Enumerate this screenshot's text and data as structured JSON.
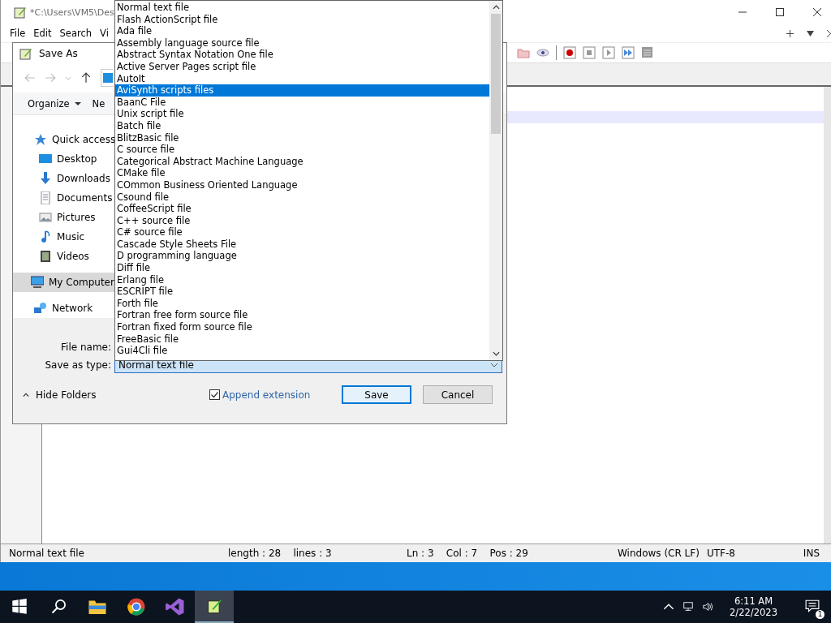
{
  "editor_window": {
    "title": "*C:\\Users\\VM5\\Des",
    "menu": [
      "File",
      "Edit",
      "Search",
      "Vi"
    ]
  },
  "save_dialog": {
    "title": "Save As",
    "commands": [
      {
        "label": "Organize",
        "kind": "menu"
      },
      {
        "label": "Ne",
        "kind": "plain"
      }
    ],
    "nav_items": [
      {
        "label": "Quick access",
        "kind": "star",
        "selected": false,
        "children": [
          {
            "label": "Desktop",
            "kind": "desktop",
            "selected": false
          },
          {
            "label": "Downloads",
            "kind": "download",
            "selected": false
          },
          {
            "label": "Documents",
            "kind": "document",
            "selected": false
          },
          {
            "label": "Pictures",
            "kind": "pictures",
            "selected": false
          },
          {
            "label": "Music",
            "kind": "music",
            "selected": false
          },
          {
            "label": "Videos",
            "kind": "videos",
            "selected": false
          }
        ]
      },
      {
        "label": "My Computer",
        "kind": "computer",
        "selected": true
      },
      {
        "label": "Network",
        "kind": "network",
        "selected": false
      }
    ],
    "file_name_label": "File name:",
    "save_type_label": "Save as type:",
    "save_type_value": "Normal text file",
    "append_extension": {
      "label": "Append extension",
      "checked": true
    },
    "hide_folders": "Hide Folders",
    "buttons": [
      {
        "label": "Save",
        "default": true
      },
      {
        "label": "Cancel",
        "default": false
      }
    ]
  },
  "type_list": [
    {
      "label": "Normal text file",
      "selected": false
    },
    {
      "label": "Flash ActionScript file",
      "selected": false
    },
    {
      "label": "Ada file",
      "selected": false
    },
    {
      "label": "Assembly language source file",
      "selected": false
    },
    {
      "label": "Abstract Syntax Notation One file",
      "selected": false
    },
    {
      "label": "Active Server Pages script file",
      "selected": false
    },
    {
      "label": "AutoIt",
      "selected": false
    },
    {
      "label": "AviSynth scripts files",
      "selected": true
    },
    {
      "label": "BaanC File",
      "selected": false
    },
    {
      "label": "Unix script file",
      "selected": false
    },
    {
      "label": "Batch file",
      "selected": false
    },
    {
      "label": "BlitzBasic file",
      "selected": false
    },
    {
      "label": "C source file",
      "selected": false
    },
    {
      "label": "Categorical Abstract Machine Language",
      "selected": false
    },
    {
      "label": "CMake file",
      "selected": false
    },
    {
      "label": "COmmon Business Oriented Language",
      "selected": false
    },
    {
      "label": "Csound file",
      "selected": false
    },
    {
      "label": "CoffeeScript file",
      "selected": false
    },
    {
      "label": "C++ source file",
      "selected": false
    },
    {
      "label": "C# source file",
      "selected": false
    },
    {
      "label": "Cascade Style Sheets File",
      "selected": false
    },
    {
      "label": "D programming language",
      "selected": false
    },
    {
      "label": "Diff file",
      "selected": false
    },
    {
      "label": "Erlang file",
      "selected": false
    },
    {
      "label": "ESCRIPT file",
      "selected": false
    },
    {
      "label": "Forth file",
      "selected": false
    },
    {
      "label": "Fortran free form source file",
      "selected": false
    },
    {
      "label": "Fortran fixed form source file",
      "selected": false
    },
    {
      "label": "FreeBasic file",
      "selected": false
    },
    {
      "label": "Gui4Cli file",
      "selected": false
    }
  ],
  "status_bar": [
    "Normal text file",
    "length : 28    lines : 3",
    "Ln : 3    Col : 7    Pos : 29",
    "Windows (CR LF)",
    "UTF-8",
    "INS"
  ],
  "taskbar": {
    "time": "6:11 AM",
    "date": "2/22/2023",
    "notifications": "1"
  }
}
